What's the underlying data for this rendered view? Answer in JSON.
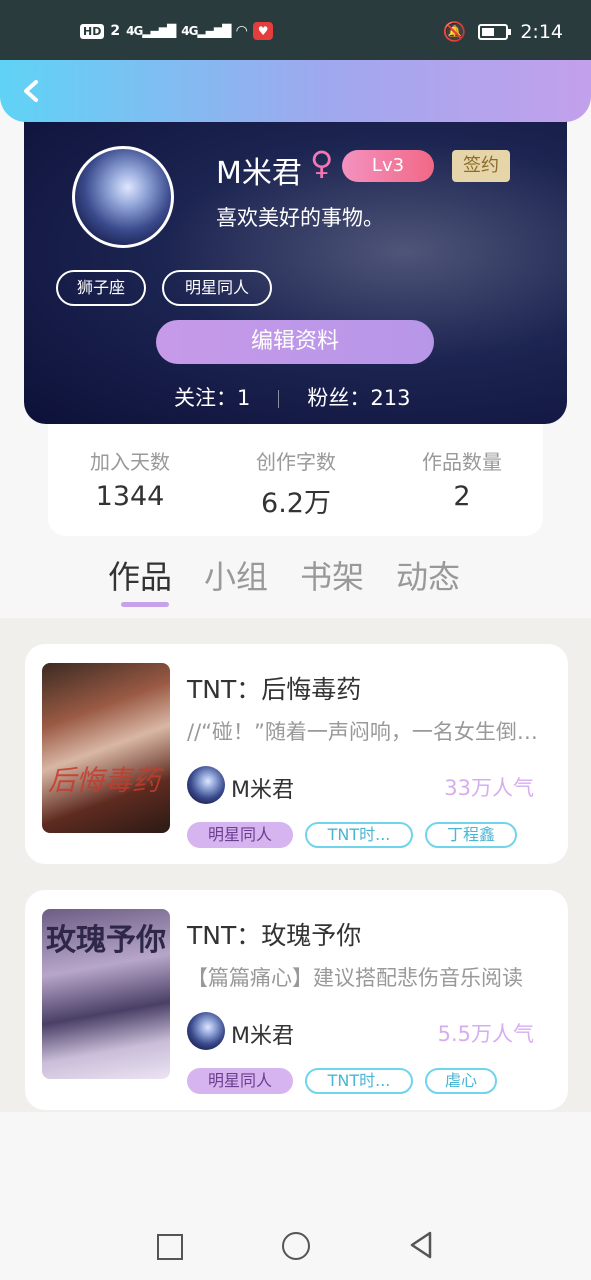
{
  "status": {
    "hd": "HD",
    "sim": "2",
    "net1": "4G",
    "net2": "4G",
    "time": "2:14"
  },
  "header": {
    "back_icon": "chevron-left-icon"
  },
  "profile": {
    "name": "M米君",
    "gender_symbol": "♀",
    "level": "Lv3",
    "signed": "签约",
    "bio": "喜欢美好的事物。",
    "tags": [
      "狮子座",
      "明星同人"
    ],
    "edit_label": "编辑资料",
    "follow": "关注：1",
    "fans": "粉丝：213"
  },
  "stats": [
    {
      "label": "加入天数",
      "value": "1344"
    },
    {
      "label": "创作字数",
      "value": "6.2万"
    },
    {
      "label": "作品数量",
      "value": "2"
    }
  ],
  "tabs": [
    "作品",
    "小组",
    "书架",
    "动态"
  ],
  "works": [
    {
      "title": "TNT：后悔毒药",
      "desc": "//“碰！”随着一声闷响，一名女生倒在了地上",
      "author": "M米君",
      "popularity": "33万人气",
      "tags": [
        "明星同人",
        "TNT时...",
        "丁程鑫"
      ],
      "cover_text": "后悔毒药"
    },
    {
      "title": "TNT：玫瑰予你",
      "desc": "【篇篇痛心】建议搭配悲伤音乐阅读",
      "author": "M米君",
      "popularity": "5.5万人气",
      "tags": [
        "明星同人",
        "TNT时...",
        "虐心"
      ],
      "cover_text": "玫瑰予你"
    }
  ],
  "colors": {
    "accent": "#c69ae8",
    "tag_cyan": "#6fd4ec",
    "card_bg": "#1c2451"
  }
}
